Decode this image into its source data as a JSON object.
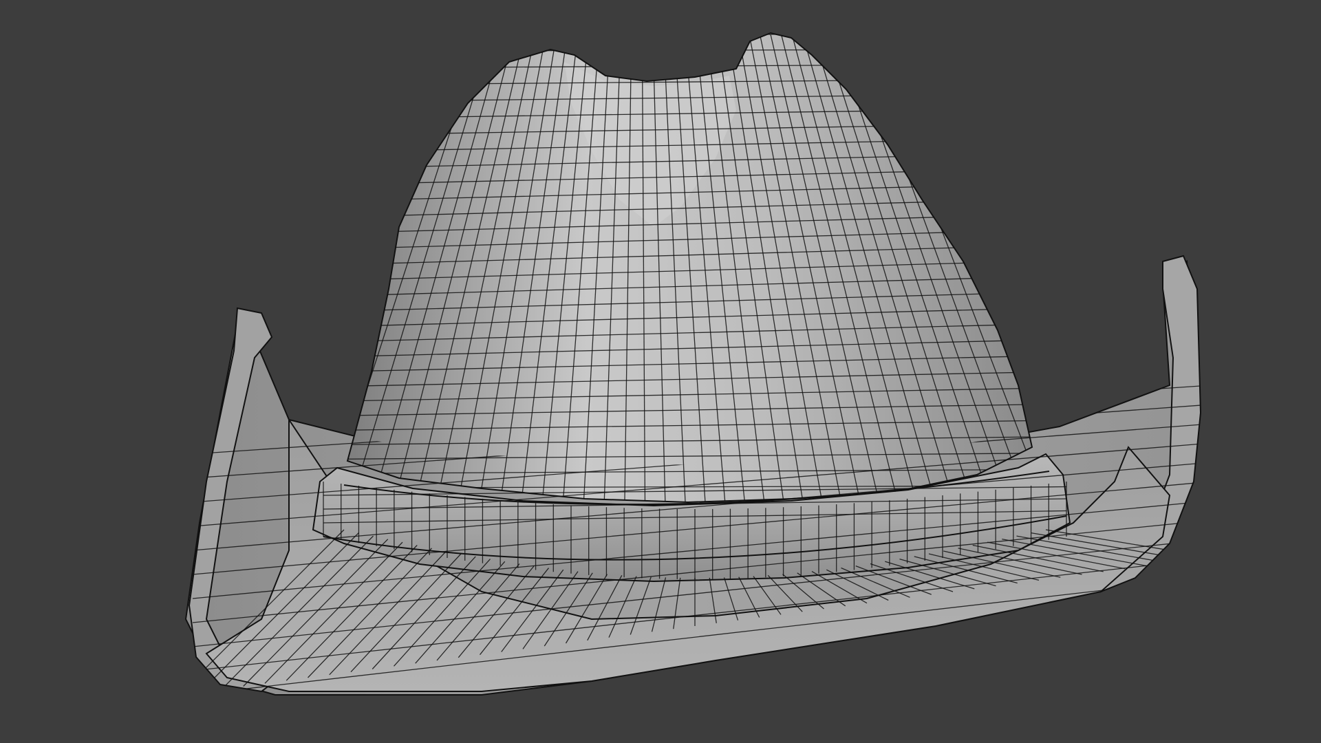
{
  "viewport": {
    "background_color": "#3d3d3d",
    "shading": "solid",
    "overlay": "wireframe"
  },
  "object": {
    "label": "cowboy-hat-mesh",
    "surface_color": "#a9a9a9",
    "highlight_color": "#cfcfcf",
    "shadow_color": "#6e6e6e",
    "wire_color": "#111111"
  }
}
